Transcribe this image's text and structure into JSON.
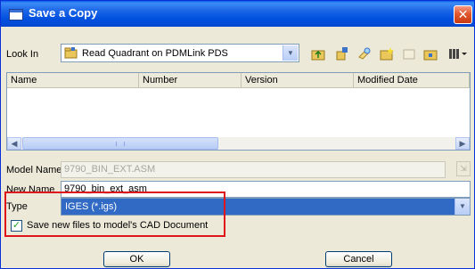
{
  "window": {
    "title": "Save a Copy",
    "close_glyph": "✕"
  },
  "look_in": {
    "label": "Look In",
    "value": "Read Quadrant on PDMLink PDS",
    "icon": "pdmlink-folder-icon"
  },
  "toolbar": {
    "icons": [
      "up-folder-icon",
      "network-icon",
      "search-icon",
      "new-folder-icon",
      "workspace-icon",
      "home-icon",
      "view-menu-icon"
    ]
  },
  "file_list": {
    "columns": [
      "Name",
      "Number",
      "Version",
      "Modified Date"
    ],
    "rows": []
  },
  "model_name": {
    "label": "Model Name",
    "value": "9790_BIN_EXT.ASM"
  },
  "new_name": {
    "label": "New Name",
    "value": "9790_bin_ext_asm"
  },
  "type": {
    "label": "Type",
    "value": "IGES (*.igs)"
  },
  "save_to_cad": {
    "label": "Save new files to model's CAD Document",
    "checked": true
  },
  "buttons": {
    "ok": "OK",
    "cancel": "Cancel"
  },
  "colors": {
    "titlebar": "#0050df",
    "selection": "#316ac5",
    "highlight_box": "#e0151c",
    "close_button": "#e2572e"
  }
}
